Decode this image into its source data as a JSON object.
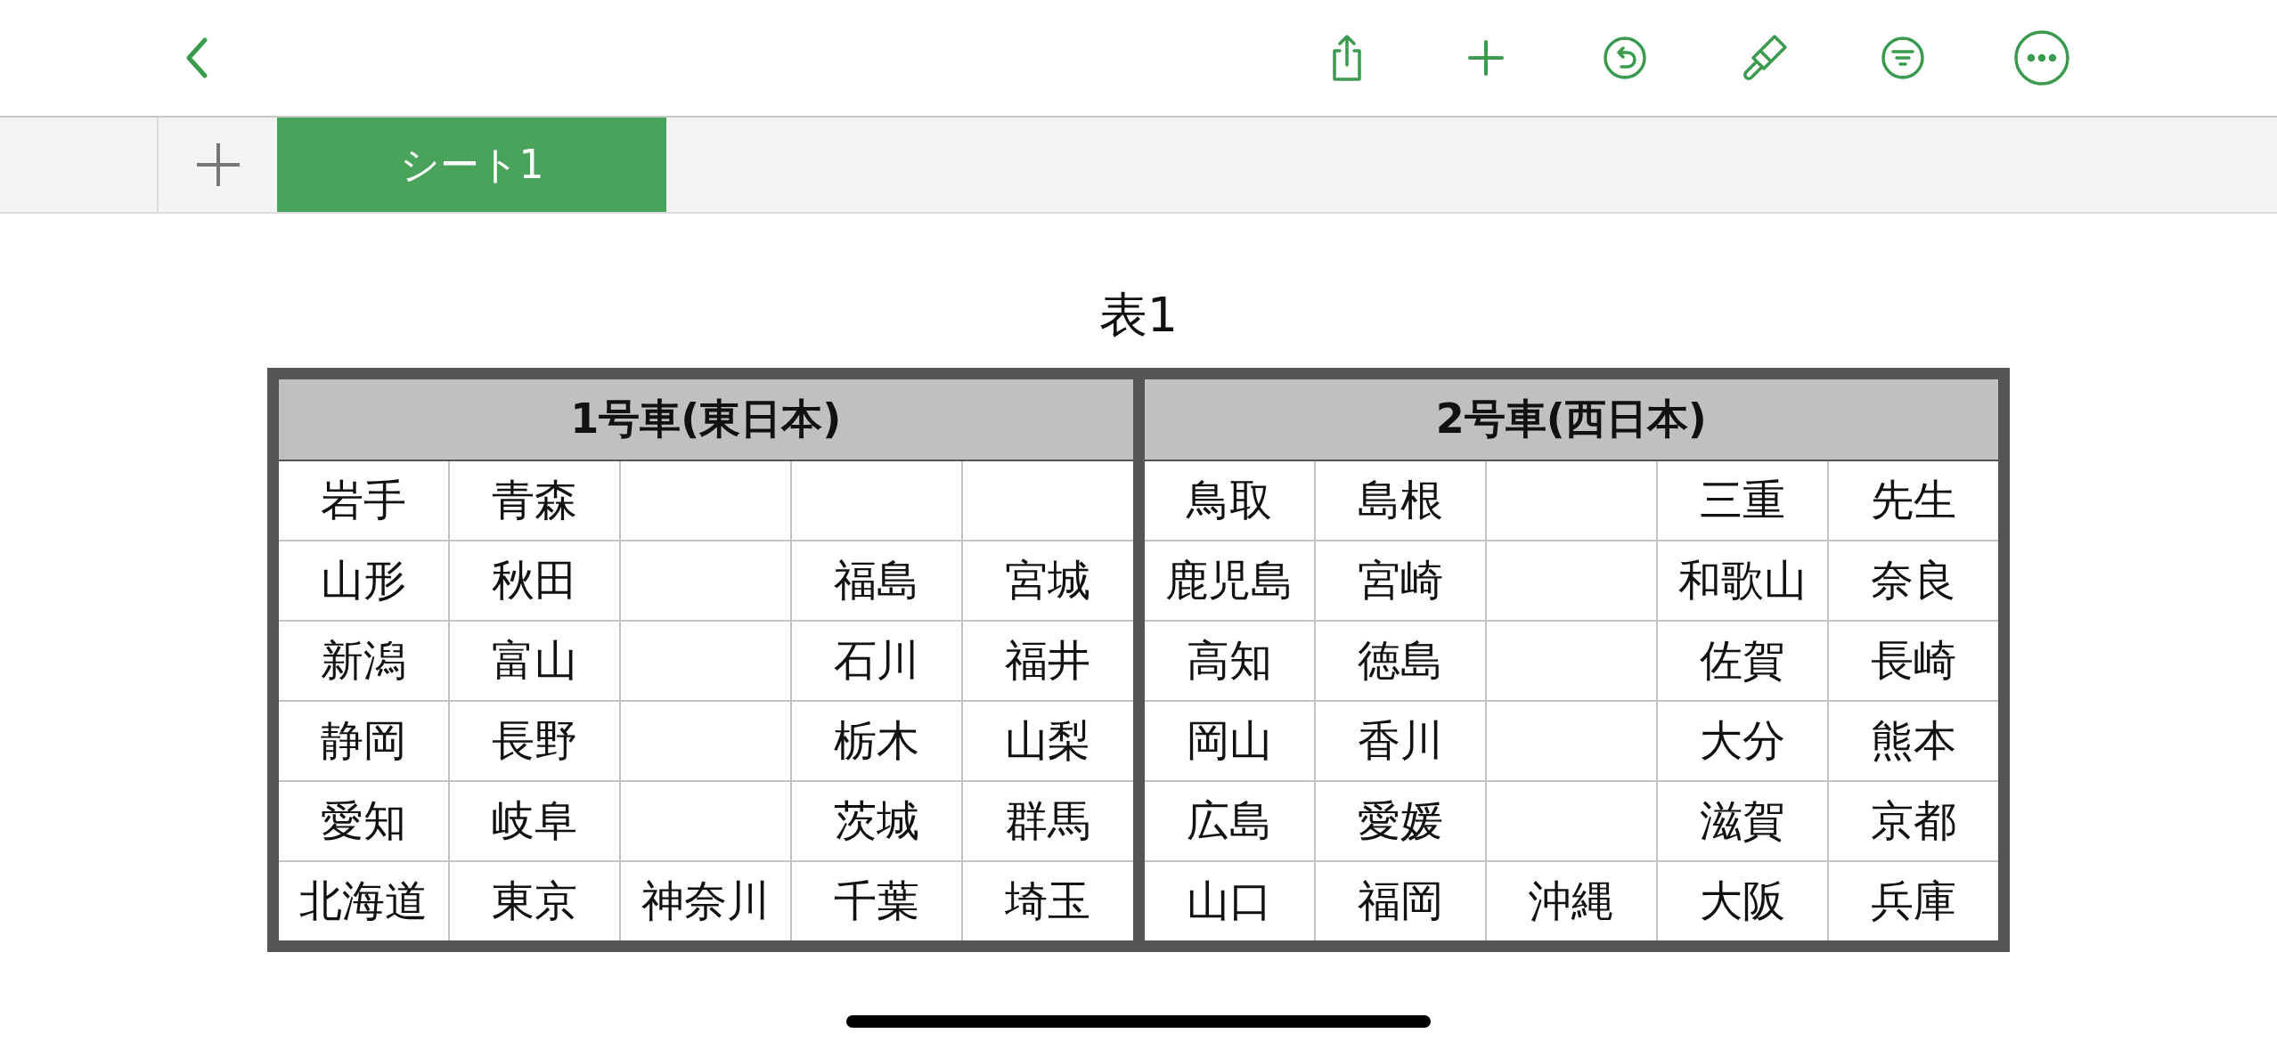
{
  "tabs": [
    {
      "label": "シート1",
      "selected": true
    }
  ],
  "table": {
    "title": "表1",
    "groups": [
      {
        "title": "1号車(東日本)",
        "rows": [
          [
            "岩手",
            "青森",
            null,
            null,
            null
          ],
          [
            "山形",
            "秋田",
            null,
            "福島",
            "宮城"
          ],
          [
            "新潟",
            "富山",
            null,
            "石川",
            "福井"
          ],
          [
            "静岡",
            "長野",
            null,
            "栃木",
            "山梨"
          ],
          [
            "愛知",
            "岐阜",
            null,
            "茨城",
            "群馬"
          ],
          [
            "北海道",
            "東京",
            "神奈川",
            "千葉",
            "埼玉"
          ]
        ]
      },
      {
        "title": "2号車(西日本)",
        "rows": [
          [
            "鳥取",
            "島根",
            null,
            "三重",
            "先生"
          ],
          [
            "鹿児島",
            "宮崎",
            null,
            "和歌山",
            "奈良"
          ],
          [
            "高知",
            "徳島",
            null,
            "佐賀",
            "長崎"
          ],
          [
            "岡山",
            "香川",
            null,
            "大分",
            "熊本"
          ],
          [
            "広島",
            "愛媛",
            null,
            "滋賀",
            "京都"
          ],
          [
            "山口",
            "福岡",
            "沖縄",
            "大阪",
            "兵庫"
          ]
        ]
      }
    ]
  }
}
